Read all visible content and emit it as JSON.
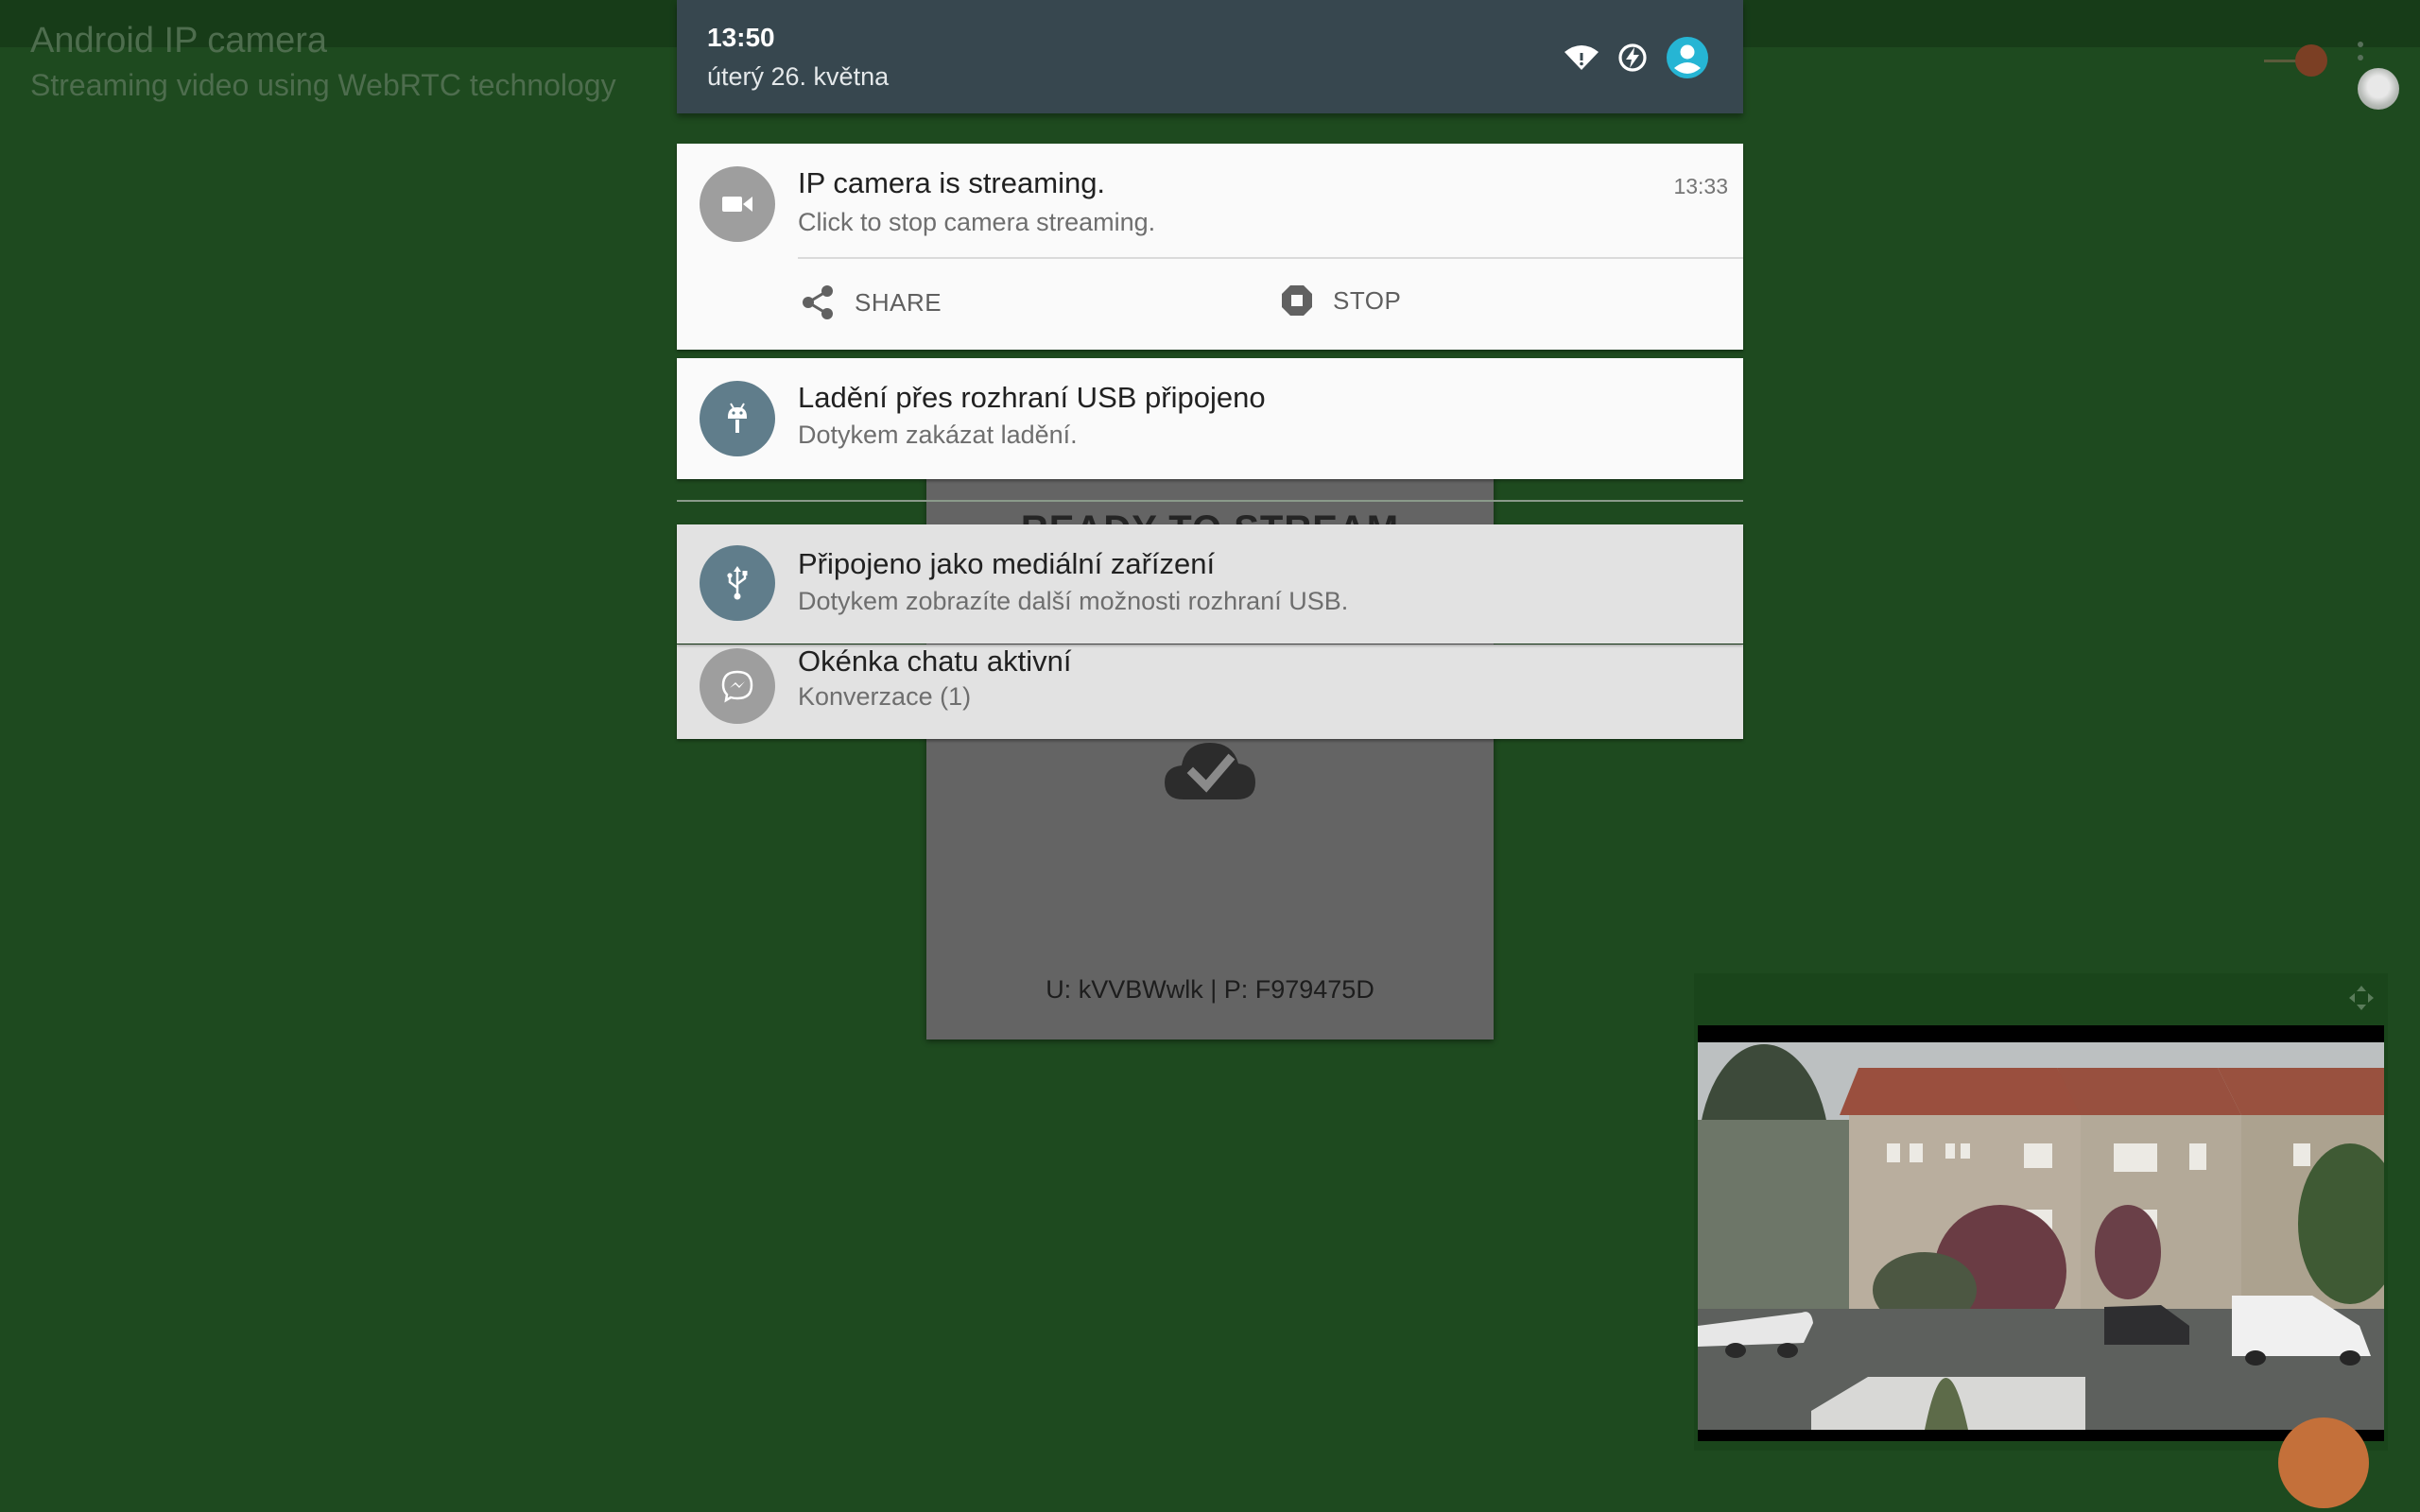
{
  "app": {
    "title": "Android IP camera",
    "subtitle": "Streaming video using WebRTC technology",
    "status_heading": "READY TO STREAM",
    "credentials": "U: kVVBWwlk | P: F979475D"
  },
  "status_bar": {
    "time": "13:50",
    "date": "úterý 26. května",
    "icons": [
      "wifi-icon",
      "data-saver-icon",
      "user-account-icon"
    ],
    "accent_color": "#26b5d4"
  },
  "notifications": [
    {
      "title": "IP camera is streaming.",
      "text": "Click to stop camera streaming.",
      "time": "13:33",
      "icon": "videocam-icon",
      "icon_color": "#9e9e9e",
      "actions": [
        {
          "label": "SHARE",
          "icon": "share-icon"
        },
        {
          "label": "STOP",
          "icon": "stop-icon"
        }
      ]
    },
    {
      "title": "Ladění přes rozhraní USB připojeno",
      "text": "Dotykem zakázat ladění.",
      "icon": "android-debug-icon",
      "icon_color": "#607d8b"
    },
    {
      "title": "Připojeno jako mediální zařízení",
      "text": "Dotykem zobrazíte další možnosti rozhraní USB.",
      "icon": "usb-icon",
      "icon_color": "#607d8b"
    },
    {
      "title": "Okénka chatu aktivní",
      "text": "Konverzace (1)",
      "icon": "messenger-icon",
      "icon_color": "#9e9e9e"
    }
  ],
  "colors": {
    "app_background": "#1e4a1f",
    "shade_header": "#37474f",
    "notification_background": "#fafafa"
  }
}
